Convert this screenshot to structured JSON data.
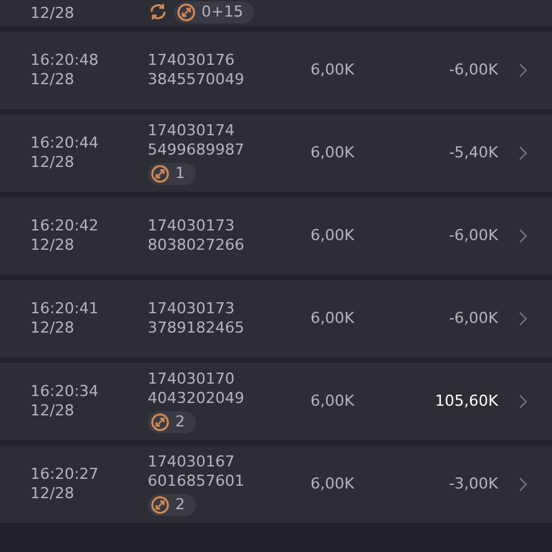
{
  "rows": [
    {
      "date": "12/28",
      "refresh": true,
      "badge": "0+15"
    },
    {
      "time": "16:20:48",
      "date": "12/28",
      "id_1": "174030176",
      "id_2": "3845570049",
      "amount": "6,00K",
      "result": "-6,00K",
      "highlight": false
    },
    {
      "time": "16:20:44",
      "date": "12/28",
      "id_1": "174030174",
      "id_2": "5499689987",
      "badge": "1",
      "amount": "6,00K",
      "result": "-5,40K",
      "highlight": false
    },
    {
      "time": "16:20:42",
      "date": "12/28",
      "id_1": "174030173",
      "id_2": "8038027266",
      "amount": "6,00K",
      "result": "-6,00K",
      "highlight": false
    },
    {
      "time": "16:20:41",
      "date": "12/28",
      "id_1": "174030173",
      "id_2": "3789182465",
      "amount": "6,00K",
      "result": "-6,00K",
      "highlight": false
    },
    {
      "time": "16:20:34",
      "date": "12/28",
      "id_1": "174030170",
      "id_2": "4043202049",
      "badge": "2",
      "amount": "6,00K",
      "result": "105,60K",
      "highlight": true
    },
    {
      "time": "16:20:27",
      "date": "12/28",
      "id_1": "174030167",
      "id_2": "6016857601",
      "badge": "2",
      "amount": "6,00K",
      "result": "-3,00K",
      "highlight": false
    }
  ]
}
